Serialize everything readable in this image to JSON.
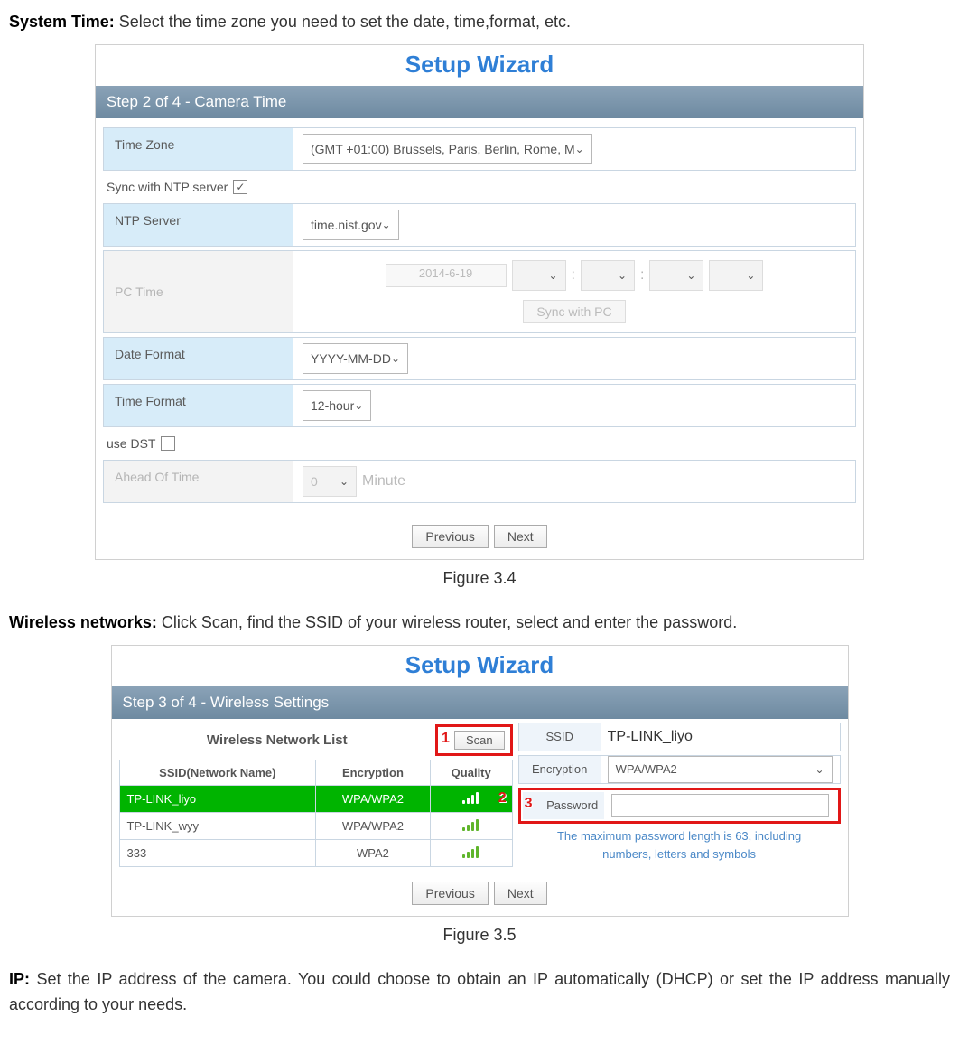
{
  "section_system_time": {
    "label": "System Time:",
    "text": " Select the time zone you need to set the date, time,format, etc."
  },
  "wizard1": {
    "title": "Setup Wizard",
    "step": "Step 2 of 4 - Camera Time",
    "time_zone_label": "Time Zone",
    "time_zone_value": "(GMT +01:00) Brussels, Paris, Berlin, Rome, M",
    "ntp_sync_label": "Sync with NTP server",
    "ntp_sync_checked": "✓",
    "ntp_server_label": "NTP Server",
    "ntp_server_value": "time.nist.gov",
    "pc_time_label": "PC Time",
    "pc_time_date": "2014-6-19",
    "sync_with_pc": "Sync with PC",
    "date_format_label": "Date Format",
    "date_format_value": "YYYY-MM-DD",
    "time_format_label": "Time Format",
    "time_format_value": "12-hour",
    "use_dst_label": "use DST",
    "ahead_label": "Ahead Of Time",
    "ahead_value": "0",
    "ahead_unit": "Minute",
    "prev": "Previous",
    "next": "Next"
  },
  "fig34": "Figure 3.4",
  "section_wireless": {
    "label": "Wireless networks:",
    "text": " Click Scan, find the SSID of your wireless router, select and enter the password."
  },
  "wizard2": {
    "title": "Setup Wizard",
    "step": "Step 3 of 4 - Wireless Settings",
    "wnl_title": "Wireless Network List",
    "scan": "Scan",
    "col_ssid": "SSID(Network Name)",
    "col_enc": "Encryption",
    "col_quality": "Quality",
    "rows": [
      {
        "ssid": "TP-LINK_liyo",
        "enc": "WPA/WPA2"
      },
      {
        "ssid": "TP-LINK_wyy",
        "enc": "WPA/WPA2"
      },
      {
        "ssid": "333",
        "enc": "WPA2"
      }
    ],
    "side_ssid_label": "SSID",
    "side_ssid_value": "TP-LINK_liyo",
    "side_enc_label": "Encryption",
    "side_enc_value": "WPA/WPA2",
    "side_pw_label": "Password",
    "hint1": "The maximum password length is 63, including",
    "hint2": "numbers, letters and symbols",
    "prev": "Previous",
    "next": "Next",
    "marker1": "1",
    "marker2": "2",
    "marker3": "3"
  },
  "fig35": "Figure 3.5",
  "section_ip": {
    "label": "IP:",
    "text": " Set the IP address of the camera. You could choose to obtain an IP automatically (DHCP) or set the IP address manually according to your needs."
  }
}
